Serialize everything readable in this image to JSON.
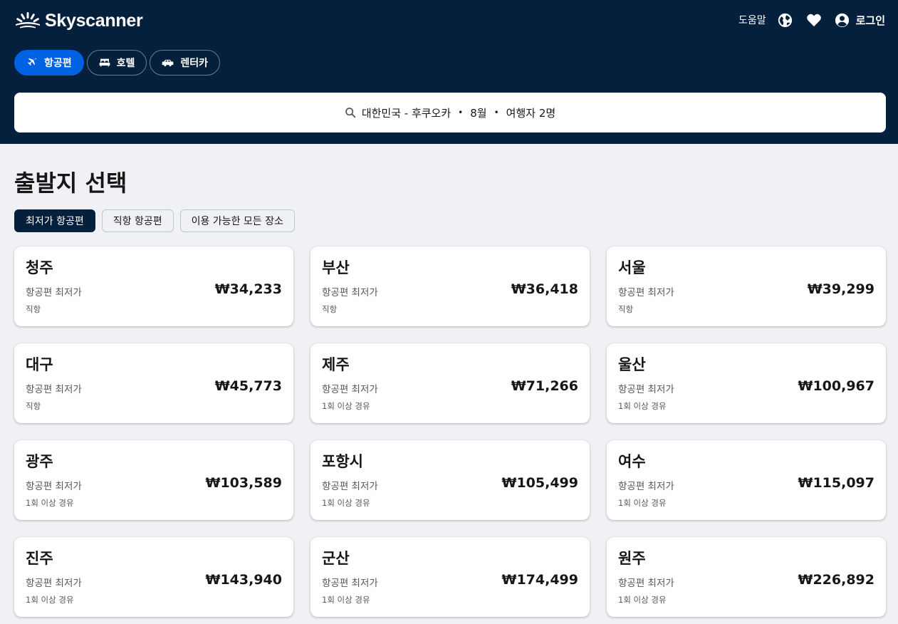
{
  "brand": {
    "name": "Skyscanner"
  },
  "top_nav": {
    "help": "도움말",
    "login": "로그인",
    "globe_icon": "globe-icon",
    "heart_icon": "heart-icon",
    "account_icon": "account-icon"
  },
  "tabs": [
    {
      "label": "항공편",
      "icon": "plane-icon",
      "active": true
    },
    {
      "label": "호텔",
      "icon": "bed-icon",
      "active": false
    },
    {
      "label": "렌터카",
      "icon": "car-icon",
      "active": false
    }
  ],
  "search": {
    "route": "대한민국 - 후쿠오카",
    "month": "8월",
    "travelers": "여행자 2명",
    "sep": "•"
  },
  "page": {
    "title": "출발지 선택"
  },
  "filters": [
    {
      "label": "최저가 항공편",
      "active": true
    },
    {
      "label": "직항 항공편",
      "active": false
    },
    {
      "label": "이용 가능한 모든 장소",
      "active": false
    }
  ],
  "destinations": [
    {
      "city": "청주",
      "label": "항공편 최저가",
      "price": "₩34,233",
      "route": "직항"
    },
    {
      "city": "부산",
      "label": "항공편 최저가",
      "price": "₩36,418",
      "route": "직항"
    },
    {
      "city": "서울",
      "label": "항공편 최저가",
      "price": "₩39,299",
      "route": "직항"
    },
    {
      "city": "대구",
      "label": "항공편 최저가",
      "price": "₩45,773",
      "route": "직항"
    },
    {
      "city": "제주",
      "label": "항공편 최저가",
      "price": "₩71,266",
      "route": "1회 이상 경유"
    },
    {
      "city": "울산",
      "label": "항공편 최저가",
      "price": "₩100,967",
      "route": "1회 이상 경유"
    },
    {
      "city": "광주",
      "label": "항공편 최저가",
      "price": "₩103,589",
      "route": "1회 이상 경유"
    },
    {
      "city": "포항시",
      "label": "항공편 최저가",
      "price": "₩105,499",
      "route": "1회 이상 경유"
    },
    {
      "city": "여수",
      "label": "항공편 최저가",
      "price": "₩115,097",
      "route": "1회 이상 경유"
    },
    {
      "city": "진주",
      "label": "항공편 최저가",
      "price": "₩143,940",
      "route": "1회 이상 경유"
    },
    {
      "city": "군산",
      "label": "항공편 최저가",
      "price": "₩174,499",
      "route": "1회 이상 경유"
    },
    {
      "city": "원주",
      "label": "항공편 최저가",
      "price": "₩226,892",
      "route": "1회 이상 경유"
    }
  ],
  "colors": {
    "header_bg": "#05203c",
    "accent": "#0062e3",
    "page_bg": "#eff1f5"
  }
}
